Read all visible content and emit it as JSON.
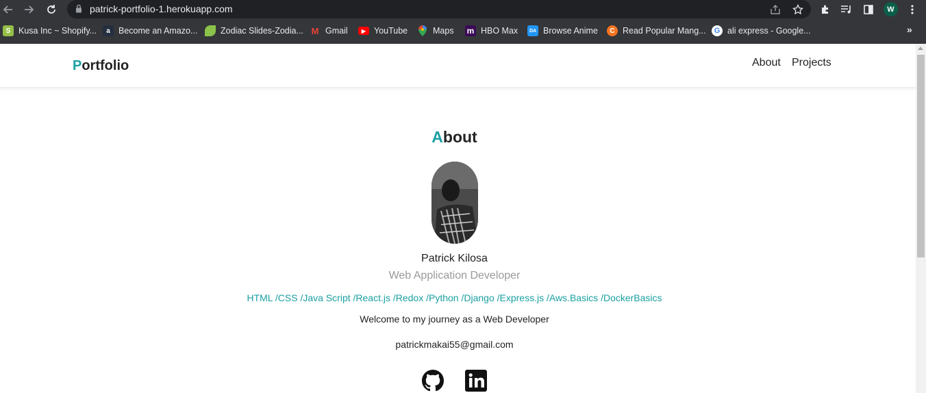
{
  "browser": {
    "url": "patrick-portfolio-1.herokuapp.com",
    "profile_initial": "W",
    "bookmarks": [
      {
        "label": "Kusa Inc ~ Shopify...",
        "icon": "shopify-icon",
        "color": "#95bf47",
        "glyph": "S"
      },
      {
        "label": "Become an Amazo...",
        "icon": "amazon-icon",
        "color": "#232f3e",
        "glyph": "a"
      },
      {
        "label": "Zodiac Slides-Zodia...",
        "icon": "leaf-icon",
        "color": "#8bc34a",
        "glyph": ""
      },
      {
        "label": "Gmail",
        "icon": "gmail-icon",
        "color": "#ea4335",
        "glyph": "M"
      },
      {
        "label": "YouTube",
        "icon": "youtube-icon",
        "color": "#ff0000",
        "glyph": "▶"
      },
      {
        "label": "Maps",
        "icon": "maps-icon",
        "color": "#34a853",
        "glyph": ""
      },
      {
        "label": "HBO Max",
        "icon": "hbomax-icon",
        "color": "#5b1a8b",
        "glyph": "m"
      },
      {
        "label": "Browse Anime",
        "icon": "deviantart-icon",
        "color": "#2196f3",
        "glyph": "DA"
      },
      {
        "label": "Read Popular Mang...",
        "icon": "crunchyroll-icon",
        "color": "#f47521",
        "glyph": "C"
      },
      {
        "label": "ali express - Google...",
        "icon": "google-icon",
        "color": "#ffffff",
        "glyph": "G"
      }
    ]
  },
  "site": {
    "brand_initial": "P",
    "brand_rest": "ortfolio",
    "nav": {
      "about": "About",
      "projects": "Projects"
    },
    "section": {
      "initial": "A",
      "rest": "bout"
    },
    "name": "Patrick Kilosa",
    "role": "Web Application Developer",
    "skills": "HTML /CSS /Java Script /React.js /Redox /Python /Django /Express.js /Aws.Basics /DockerBasics",
    "welcome": "Welcome to my journey as a Web Developer",
    "email": "patrickmakai55@gmail.com"
  },
  "colors": {
    "accent": "#1aa0a3",
    "muted": "#999999",
    "chrome": "#35363a"
  }
}
